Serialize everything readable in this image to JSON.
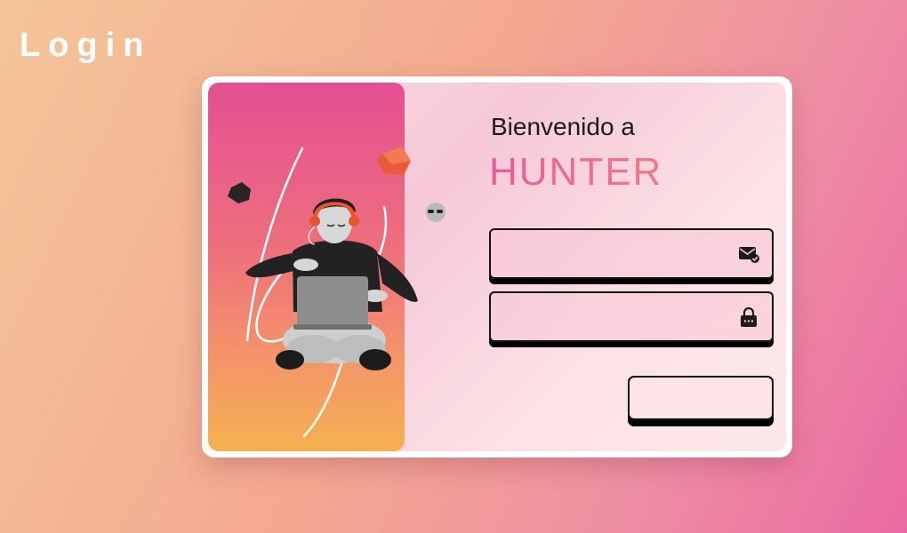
{
  "page": {
    "title": "Login"
  },
  "welcome": {
    "line1": "Bienvenido a",
    "brand": "HUNTER"
  },
  "form": {
    "email": {
      "value": "",
      "placeholder": "",
      "icon": "mail-check-icon"
    },
    "password": {
      "value": "",
      "placeholder": "",
      "icon": "lock-icon"
    },
    "submit_label": ""
  },
  "colors": {
    "hero_top": "#e44f92",
    "hero_bottom": "#f5b04f",
    "brand_start": "#e95a9a",
    "brand_end": "#f07a85"
  }
}
